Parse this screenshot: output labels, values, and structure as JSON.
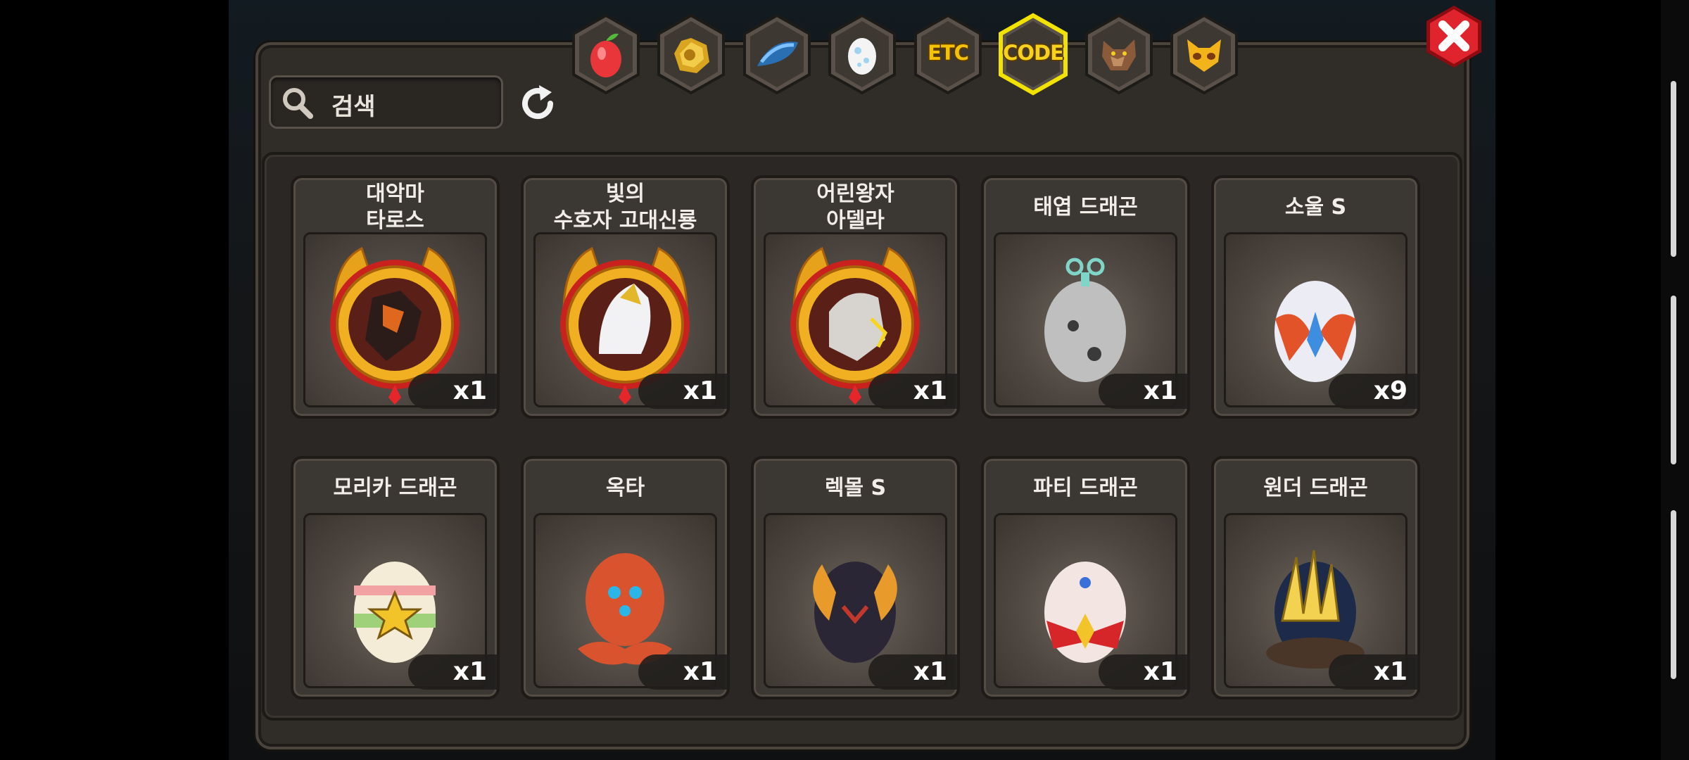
{
  "search": {
    "placeholder": "검색"
  },
  "tabs": [
    {
      "id": "fruit",
      "icon": "fruit-icon",
      "label": ""
    },
    {
      "id": "gold",
      "icon": "gold-nugget-icon",
      "label": ""
    },
    {
      "id": "feather",
      "icon": "blue-feather-icon",
      "label": ""
    },
    {
      "id": "egg",
      "icon": "egg-icon",
      "label": ""
    },
    {
      "id": "etc",
      "icon": "",
      "label": "ETC"
    },
    {
      "id": "code",
      "icon": "",
      "label": "CODE",
      "active": true
    },
    {
      "id": "beast",
      "icon": "wolf-head-icon",
      "label": ""
    },
    {
      "id": "cat",
      "icon": "cat-mask-icon",
      "label": ""
    }
  ],
  "items": [
    {
      "name": "대악마\n타로스",
      "qty": "x1",
      "icon": "demon-medal-icon"
    },
    {
      "name": "빛의\n수호자 고대신룡",
      "qty": "x1",
      "icon": "white-dragon-medal-icon"
    },
    {
      "name": "어린왕자\n아델라",
      "qty": "x1",
      "icon": "robot-dragon-medal-icon"
    },
    {
      "name": "태엽 드래곤",
      "qty": "x1",
      "icon": "clockwork-egg-icon"
    },
    {
      "name": "소울 S",
      "qty": "x9",
      "icon": "soul-egg-icon"
    },
    {
      "name": "모리카 드래곤",
      "qty": "x1",
      "icon": "star-egg-icon"
    },
    {
      "name": "옥타",
      "qty": "x1",
      "icon": "octopus-egg-icon"
    },
    {
      "name": "렉몰 S",
      "qty": "x1",
      "icon": "horned-egg-icon"
    },
    {
      "name": "파티 드래곤",
      "qty": "x1",
      "icon": "ribbon-egg-icon"
    },
    {
      "name": "원더 드래곤",
      "qty": "x1",
      "icon": "crystal-nest-egg-icon"
    }
  ],
  "colors": {
    "tab_highlight": "#f2e200",
    "panel": "#302c27",
    "close": "#d4202a"
  }
}
